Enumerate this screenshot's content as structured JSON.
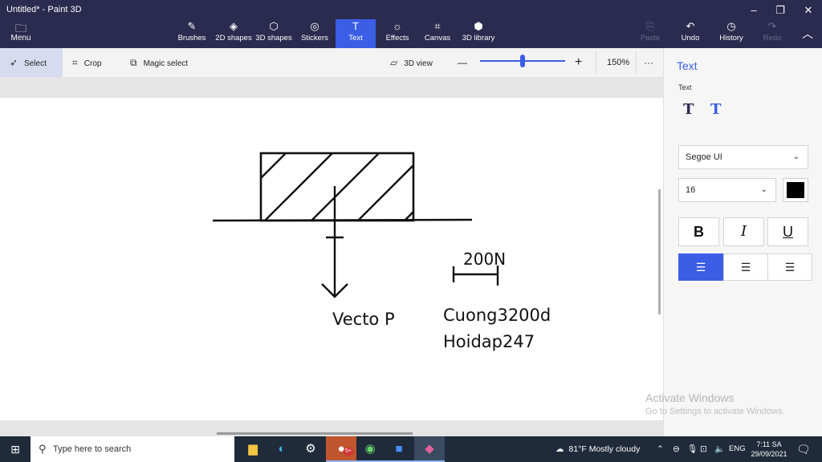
{
  "window": {
    "title": "Untitled* - Paint 3D",
    "minimize": "–",
    "maximize": "❐",
    "close": "✕"
  },
  "ribbon": {
    "menu": {
      "label": "Menu",
      "icon": "folder-icon",
      "glyph": "🗀"
    },
    "tools": [
      {
        "label": "Brushes",
        "icon": "brush-icon",
        "glyph": "✎"
      },
      {
        "label": "2D shapes",
        "icon": "shapes-2d-icon",
        "glyph": "◈"
      },
      {
        "label": "3D shapes",
        "icon": "cube-icon",
        "glyph": "⬡"
      },
      {
        "label": "Stickers",
        "icon": "sticker-icon",
        "glyph": "◎"
      },
      {
        "label": "Text",
        "icon": "text-icon",
        "glyph": "T"
      },
      {
        "label": "Effects",
        "icon": "effects-icon",
        "glyph": "☼"
      },
      {
        "label": "Canvas",
        "icon": "canvas-icon",
        "glyph": "⌗"
      },
      {
        "label": "3D library",
        "icon": "library-icon",
        "glyph": "⬢"
      }
    ],
    "actions": [
      {
        "label": "Paste",
        "icon": "paste-icon",
        "glyph": "⎘"
      },
      {
        "label": "Undo",
        "icon": "undo-icon",
        "glyph": "↶"
      },
      {
        "label": "History",
        "icon": "history-icon",
        "glyph": "◷"
      },
      {
        "label": "Redo",
        "icon": "redo-icon",
        "glyph": "↷"
      }
    ],
    "collapse_glyph": "︿"
  },
  "toolbar": {
    "select": "Select",
    "crop": "Crop",
    "magic_select": "Magic select",
    "view3d": "3D view",
    "zoom_out": "—",
    "zoom_in": "+",
    "zoom": "150%",
    "more": "···"
  },
  "drawing": {
    "vecto_label": "Vecto P",
    "scale_label": "200N",
    "credit_line1": "Cuong3200d",
    "credit_line2": "Hoidap247"
  },
  "watermark": {
    "line1": "Activate Windows",
    "line2": "Go to Settings to activate Windows."
  },
  "panel": {
    "title": "Text",
    "subtitle": "Text",
    "font": "Segoe UI",
    "size": "16",
    "color": "#000000",
    "bold": "B",
    "italic": "I",
    "underline": "U",
    "align_glyph": "☰"
  },
  "taskbar": {
    "search_placeholder": "Type here to search",
    "weather": "81°F  Mostly cloudy",
    "lang": "ENG",
    "time": "7:11 SA",
    "date": "29/09/2021",
    "badge": "5+"
  },
  "colors": {
    "ribbon": "#2b2b4f",
    "accent": "#3c5ee6",
    "taskbar": "#1f2a3a"
  }
}
